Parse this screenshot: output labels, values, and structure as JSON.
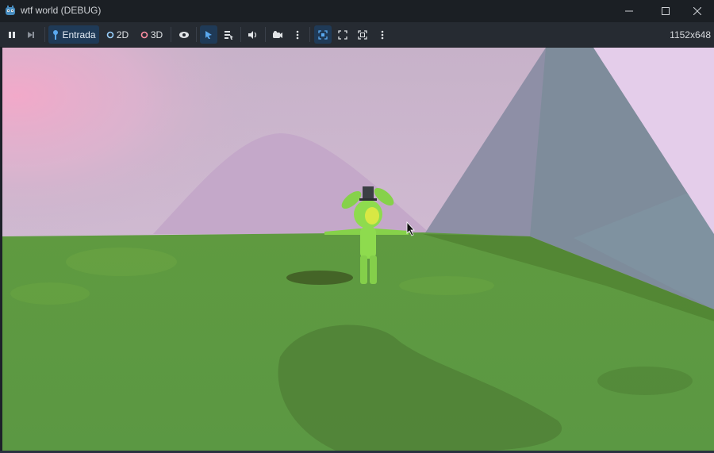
{
  "window": {
    "title": "wtf world (DEBUG)",
    "icon": "godot-icon",
    "controls": [
      "minimize-icon",
      "maximize-icon",
      "close-icon"
    ]
  },
  "toolbar": {
    "pause_icon": "pause-icon",
    "next_frame_icon": "next-frame-icon",
    "input_label": "Entrada",
    "mode_2d_label": "2D",
    "mode_3d_label": "3D",
    "resolution": "1152x648",
    "colors": {
      "active_bg": "#1f3a57",
      "accent_blue": "#5aa9f0",
      "dot_2d": "#9ad2ff",
      "dot_3d": "#ff8fa3"
    }
  },
  "scene": {
    "sky_color": "#c9aec9",
    "grass_color": "#5d9a41",
    "character_color": "#8edb4e"
  }
}
